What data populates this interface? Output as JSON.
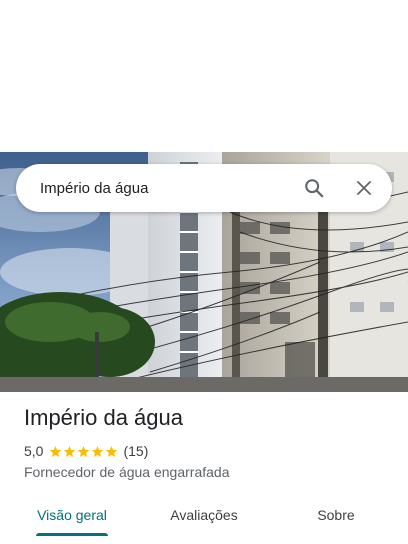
{
  "search": {
    "query": "Império da água"
  },
  "place": {
    "name": "Império da água",
    "rating": "5,0",
    "rating_value": 5.0,
    "review_count": "(15)",
    "category": "Fornecedor de água engarrafada"
  },
  "tabs": [
    {
      "label": "Visão geral",
      "active": true
    },
    {
      "label": "Avaliações",
      "active": false
    },
    {
      "label": "Sobre",
      "active": false
    }
  ],
  "icons": {
    "search": "search-icon",
    "close": "close-icon",
    "star": "star-icon"
  },
  "colors": {
    "accent": "#00737a",
    "star": "#fbbc04",
    "text": "#202124",
    "secondary_text": "#5f6368"
  }
}
